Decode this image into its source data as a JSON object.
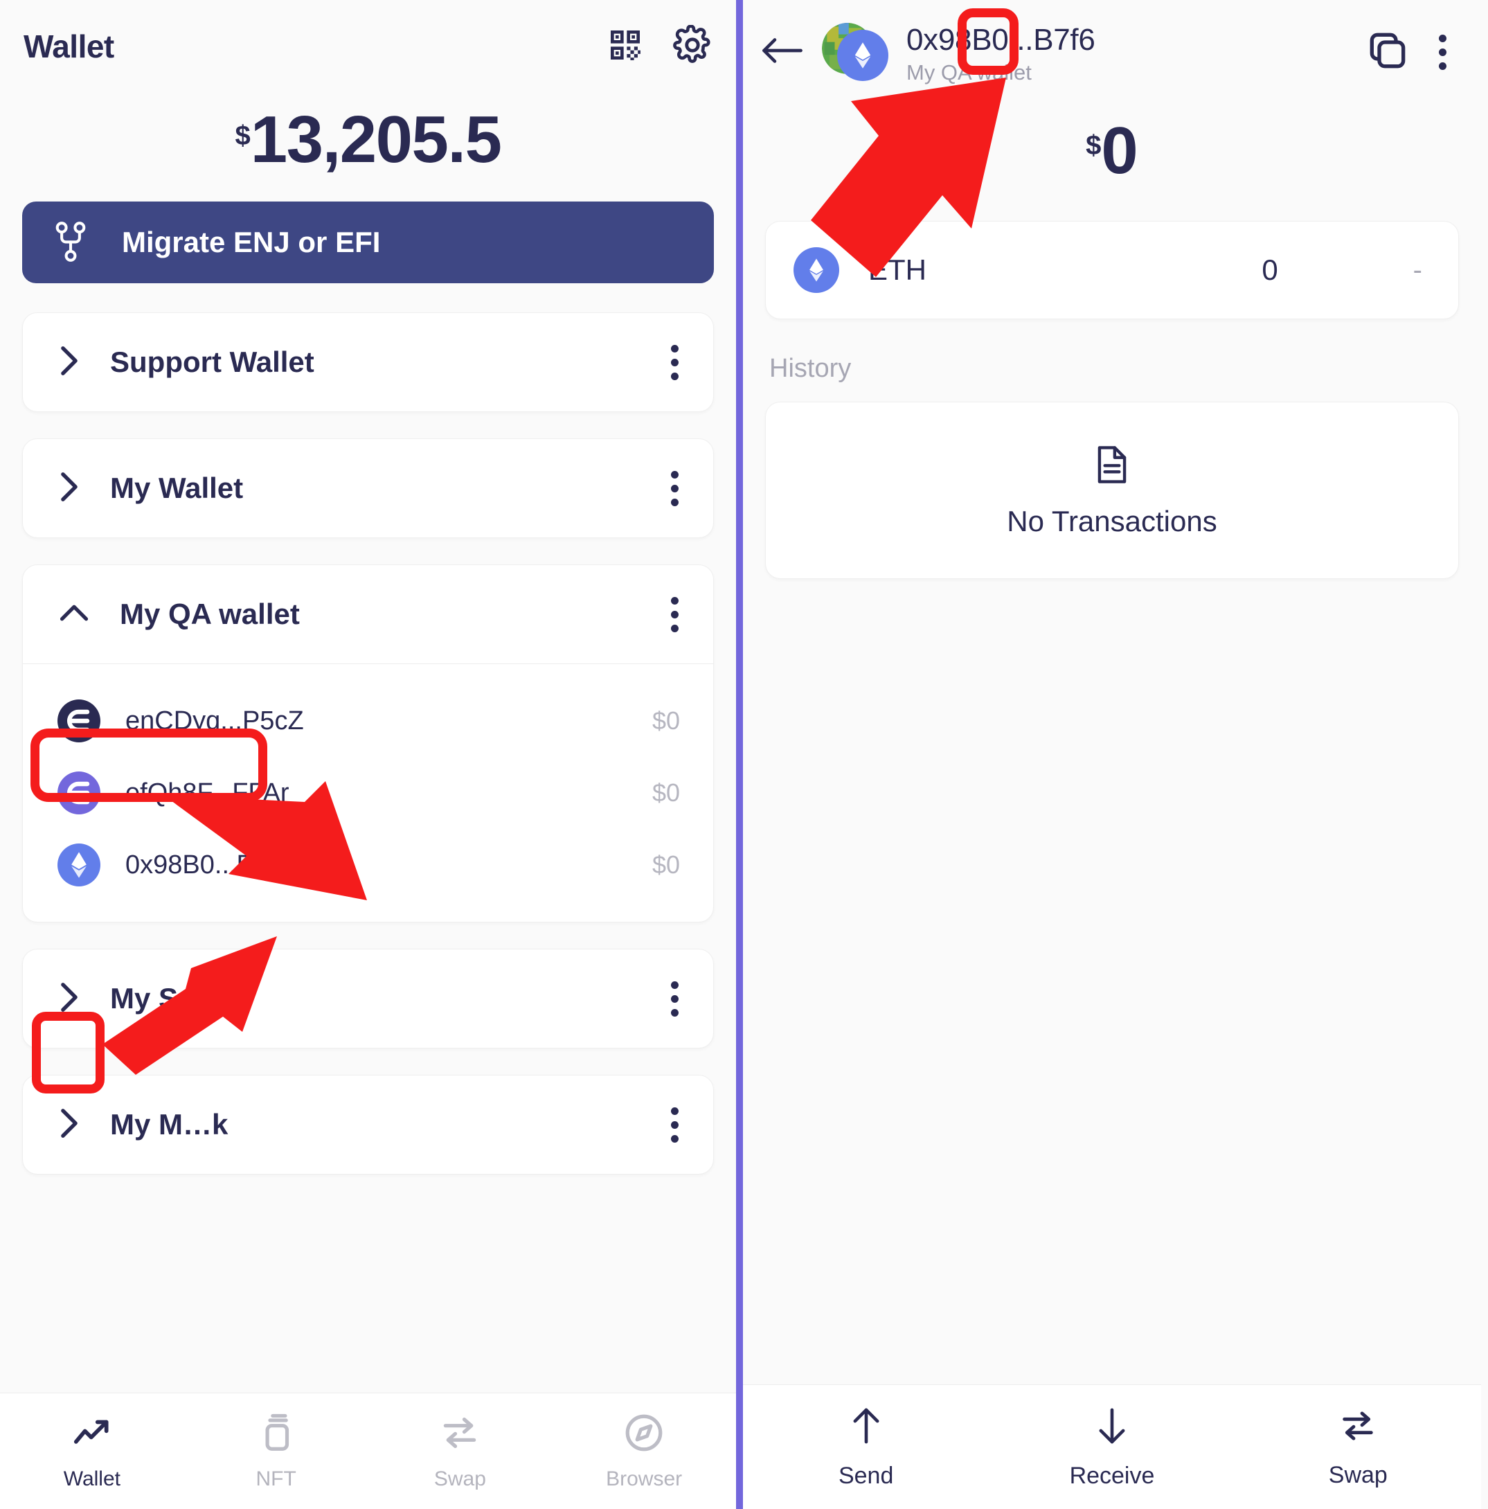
{
  "left": {
    "title": "Wallet",
    "header_icons": [
      {
        "name": "qr-scan-icon",
        "label": "qr-scan"
      },
      {
        "name": "gear-icon",
        "label": "settings"
      }
    ],
    "balance": {
      "currency": "$",
      "amount": "13,205.5"
    },
    "migrate_button": {
      "label": "Migrate ENJ or EFI",
      "icon": "migrate-branch-icon",
      "color": "#3e4784"
    },
    "wallets": [
      {
        "name": "Support Wallet",
        "expanded": false,
        "chevron": "chevron-right-icon",
        "tokens": []
      },
      {
        "name": "My Wallet",
        "expanded": false,
        "chevron": "chevron-right-icon",
        "tokens": []
      },
      {
        "name": "My QA wallet",
        "expanded": true,
        "chevron": "chevron-up-icon",
        "tokens": [
          {
            "label": "enCDyq...P5cZ",
            "value": "$0",
            "icon": "enjin-dark-icon",
            "color": "#2a2a52",
            "highlighted": false
          },
          {
            "label": "efQh8F...FFAr",
            "value": "$0",
            "icon": "enjin-purple-icon",
            "color": "#7367dc",
            "highlighted": false
          },
          {
            "label": "0x98B0...B7f6",
            "value": "$0",
            "icon": "ethereum-icon",
            "color": "#627eea",
            "highlighted": true
          }
        ]
      },
      {
        "name": "My Safe",
        "expanded": false,
        "chevron": "chevron-right-icon",
        "tokens": []
      },
      {
        "name": "My M…k",
        "expanded": false,
        "chevron": "chevron-right-icon",
        "tokens": []
      }
    ],
    "bottom_nav": [
      {
        "label": "Wallet",
        "icon": "chart-trend-icon",
        "active": true
      },
      {
        "label": "NFT",
        "icon": "nft-cards-icon",
        "active": false
      },
      {
        "label": "Swap",
        "icon": "swap-arrows-icon",
        "active": false
      },
      {
        "label": "Browser",
        "icon": "compass-icon",
        "active": false
      }
    ]
  },
  "right": {
    "back_icon": "arrow-left-icon",
    "avatar": {
      "base": "globe-identicon",
      "overlay": "ethereum-icon"
    },
    "address": "0x98B0...B7f6",
    "wallet_name": "My QA wallet",
    "actions": [
      {
        "name": "copy-address-button",
        "icon": "copy-icon",
        "highlighted": true
      },
      {
        "name": "more-options-button",
        "icon": "kebab-menu-icon",
        "highlighted": false
      }
    ],
    "balance": {
      "currency": "$",
      "amount": "0"
    },
    "asset": {
      "symbol": "ETH",
      "amount": "0",
      "change": "-",
      "icon": "ethereum-icon"
    },
    "history_label": "History",
    "empty_state": {
      "text": "No Transactions",
      "icon": "document-icon"
    },
    "bottom_actions": [
      {
        "label": "Send",
        "icon": "arrow-up-icon"
      },
      {
        "label": "Receive",
        "icon": "arrow-down-icon"
      },
      {
        "label": "Swap",
        "icon": "swap-arrows-icon"
      }
    ]
  },
  "annotations": {
    "accent_color": "#f41c1c",
    "highlight_boxes": [
      "copy-address-button",
      "token-0x98B0...B7f6",
      "nav-item-wallet"
    ],
    "arrows": 3
  }
}
